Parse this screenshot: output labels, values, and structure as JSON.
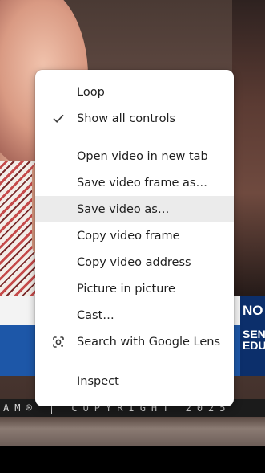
{
  "video": {
    "lower_third_tag_1": "NO",
    "lower_third_tag_2": "SEN\nEDU",
    "copyright_text": "AM® | COPYRIGHT 2025"
  },
  "context_menu": {
    "items": [
      {
        "label": "Loop"
      },
      {
        "label": "Show all controls",
        "checked": true,
        "icon": "checkmark-icon"
      },
      {
        "label": "Open video in new tab"
      },
      {
        "label": "Save video frame as…"
      },
      {
        "label": "Save video as…",
        "highlighted": true
      },
      {
        "label": "Copy video frame"
      },
      {
        "label": "Copy video address"
      },
      {
        "label": "Picture in picture"
      },
      {
        "label": "Cast…"
      },
      {
        "label": "Search with Google Lens",
        "icon": "google-lens-icon"
      },
      {
        "label": "Inspect"
      }
    ]
  },
  "colors": {
    "menu_background": "#ffffff",
    "hover_background": "#ebebeb",
    "separator": "#d9e2ef",
    "text": "#1f1f1f"
  }
}
